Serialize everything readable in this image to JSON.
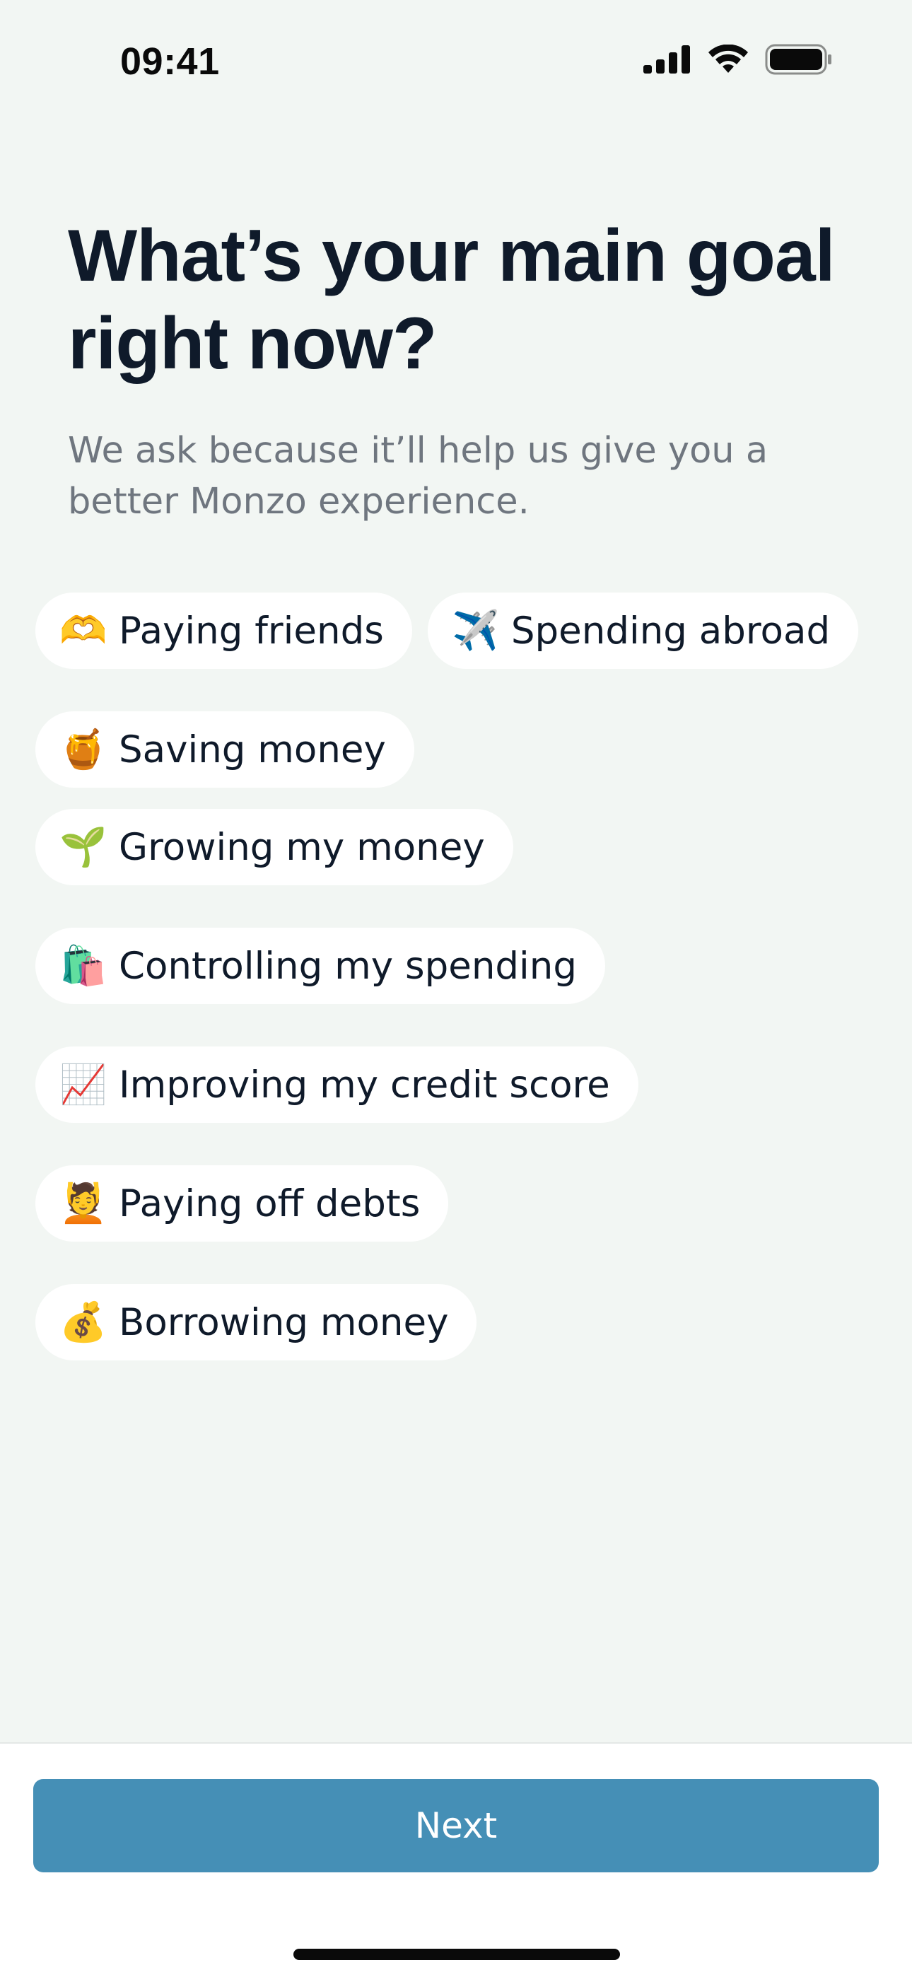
{
  "status_bar": {
    "time": "09:41"
  },
  "screen": {
    "title": "What’s your main goal right now?",
    "subtitle": "We ask because it’ll help us give you a better Monzo experience."
  },
  "goals": [
    {
      "icon": "heart-hands-icon",
      "emoji": "🫶",
      "label": "Paying friends"
    },
    {
      "icon": "airplane-icon",
      "emoji": "✈️",
      "label": "Spending abroad"
    },
    {
      "icon": "honey-pot-icon",
      "emoji": "🍯",
      "label": "Saving money"
    },
    {
      "icon": "seedling-icon",
      "emoji": "🌱",
      "label": "Growing my money"
    },
    {
      "icon": "shopping-bags-icon",
      "emoji": "🛍️",
      "label": "Controlling my spending"
    },
    {
      "icon": "chart-increasing-icon",
      "emoji": "📈",
      "label": "Improving my credit score"
    },
    {
      "icon": "relieved-person-icon",
      "emoji": "💆",
      "label": "Paying off debts"
    },
    {
      "icon": "money-bag-icon",
      "emoji": "💰",
      "label": "Borrowing money"
    }
  ],
  "footer": {
    "next_label": "Next"
  },
  "colors": {
    "background": "#f2f6f3",
    "chip_background": "#ffffff",
    "primary_button": "#458fb6",
    "title_text": "#0f1a2a",
    "subtitle_text": "#6f767f"
  }
}
